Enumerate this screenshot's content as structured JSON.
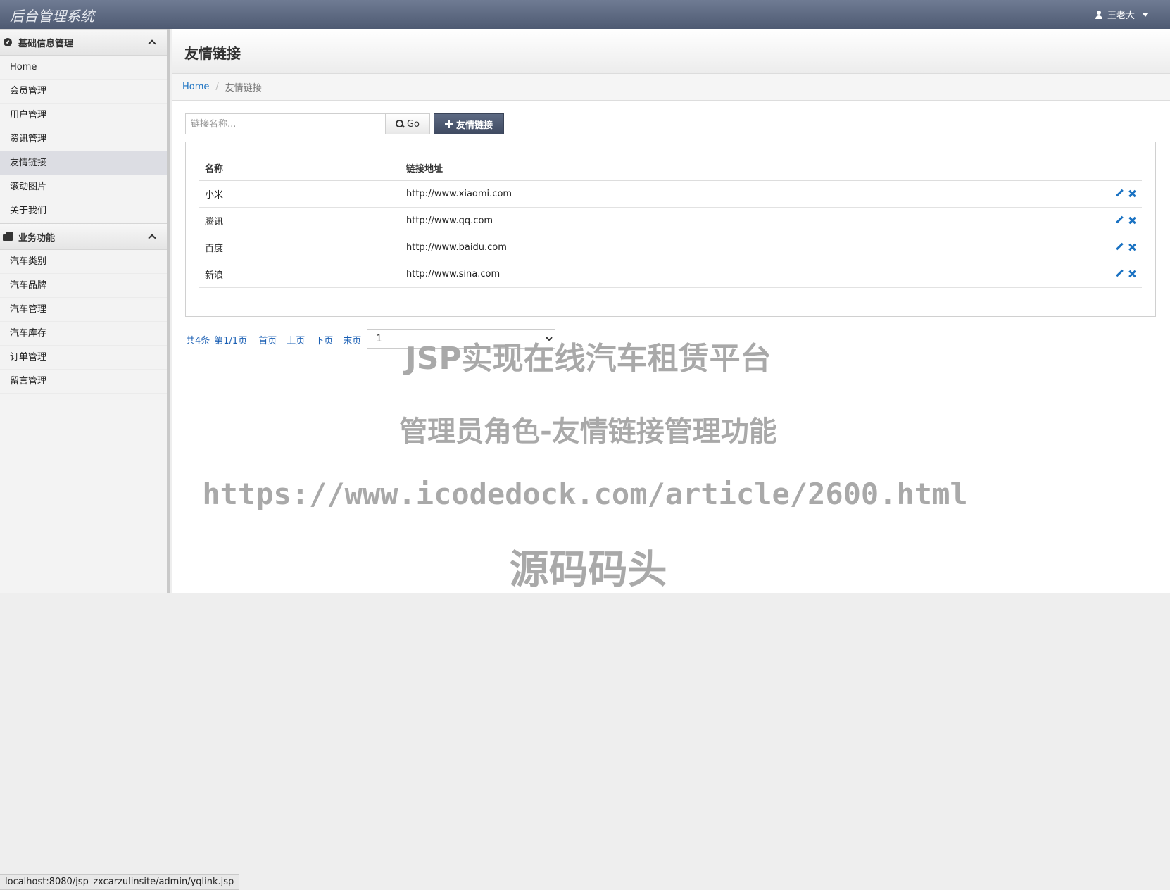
{
  "header": {
    "brand": "后台管理系统",
    "user_name": "王老大"
  },
  "sidebar": {
    "groups": [
      {
        "title": "基础信息管理",
        "icon": "dashboard-icon",
        "items": [
          {
            "label": "Home"
          },
          {
            "label": "会员管理"
          },
          {
            "label": "用户管理"
          },
          {
            "label": "资讯管理"
          },
          {
            "label": "友情链接",
            "active": true
          },
          {
            "label": "滚动图片"
          },
          {
            "label": "关于我们"
          }
        ]
      },
      {
        "title": "业务功能",
        "icon": "briefcase-icon",
        "items": [
          {
            "label": "汽车类别"
          },
          {
            "label": "汽车品牌"
          },
          {
            "label": "汽车管理"
          },
          {
            "label": "汽车库存"
          },
          {
            "label": "订单管理"
          },
          {
            "label": "留言管理"
          }
        ]
      }
    ]
  },
  "main": {
    "page_title": "友情链接",
    "breadcrumb": {
      "home": "Home",
      "current": "友情链接"
    },
    "search": {
      "placeholder": "链接名称...",
      "value": "",
      "go_label": "Go"
    },
    "add_label": "友情链接",
    "table": {
      "columns": [
        "名称",
        "链接地址"
      ],
      "rows": [
        {
          "name": "小米",
          "url": "http://www.xiaomi.com"
        },
        {
          "name": "腾讯",
          "url": "http://www.qq.com"
        },
        {
          "name": "百度",
          "url": "http://www.baidu.com"
        },
        {
          "name": "新浪",
          "url": "http://www.sina.com"
        }
      ]
    },
    "pagination": {
      "total": "共4条",
      "page_info": "第1/1页",
      "first": "首页",
      "prev": "上页",
      "next": "下页",
      "last": "末页",
      "selected_page": "1"
    }
  },
  "overlay": {
    "line1": "JSP实现在线汽车租赁平台",
    "line2": "管理员角色-友情链接管理功能",
    "line3": "https://www.icodedock.com/article/2600.html",
    "line4": "源码码头"
  },
  "status_bar": "localhost:8080/jsp_zxcarzulinsite/admin/yqlink.jsp",
  "colors": {
    "navbar": "#5c6880",
    "link": "#1a72c2",
    "active_item": "#dcdde3",
    "add_button": "#4a556c"
  }
}
